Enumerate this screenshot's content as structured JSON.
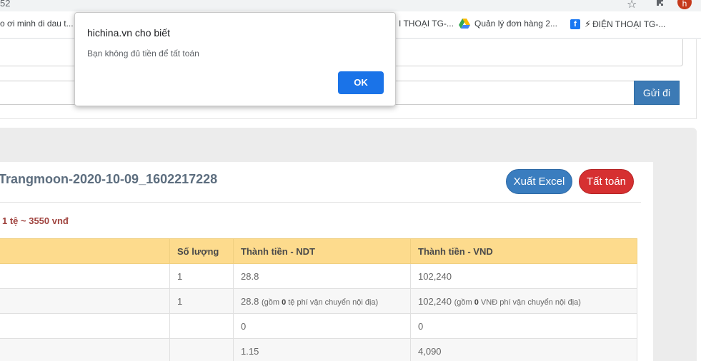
{
  "browser": {
    "address": "52",
    "avatar_letter": "h",
    "bookmarks": [
      {
        "label": "o ơi minh di dau t...",
        "icon": "none"
      },
      {
        "label": "I THOẠI TG-...",
        "icon": "none"
      },
      {
        "label": "Quản lý đơn hàng 2...",
        "icon": "drive-icon"
      },
      {
        "label": "ĐIỆN THOẠI TG-...",
        "icon": "facebook-icon"
      }
    ]
  },
  "chat": {
    "send_label": "Gửi đi"
  },
  "order": {
    "title": "Trangmoon-2020-10-09_1602217228",
    "export_label": "Xuất Excel",
    "settle_label": "Tất toán",
    "rate_text": "1 tệ ~ 3550 vnđ"
  },
  "table": {
    "headers": [
      "",
      "Số lượng",
      "Thành tiền - NDT",
      "Thành tiền - VND"
    ],
    "rows": [
      {
        "qty": "1",
        "ndt": "28.8",
        "ndt_note": null,
        "vnd": "102,240",
        "vnd_note": null
      },
      {
        "qty": "1",
        "ndt": "28.8",
        "ndt_note": {
          "pre": "(gồm ",
          "val": "0",
          "post": " tệ phí vận chuyển nội địa)"
        },
        "vnd": "102,240",
        "vnd_note": {
          "pre": "(gồm ",
          "val": "0",
          "post": " VNĐ phí vận chuyển nội địa)"
        }
      },
      {
        "qty": "",
        "ndt": "0",
        "ndt_note": null,
        "vnd": "0",
        "vnd_note": null
      },
      {
        "qty": "",
        "ndt": "1.15",
        "ndt_note": null,
        "vnd": "4,090",
        "vnd_note": null
      }
    ]
  },
  "dialog": {
    "title": "hichina.vn cho biết",
    "message": "Bạn không đủ tiền để tất toán",
    "ok_label": "OK"
  },
  "colors": {
    "accent": "#1a73e8",
    "header_row": "#fddb8d",
    "danger": "#d63031",
    "primary": "#3a7dbf"
  }
}
